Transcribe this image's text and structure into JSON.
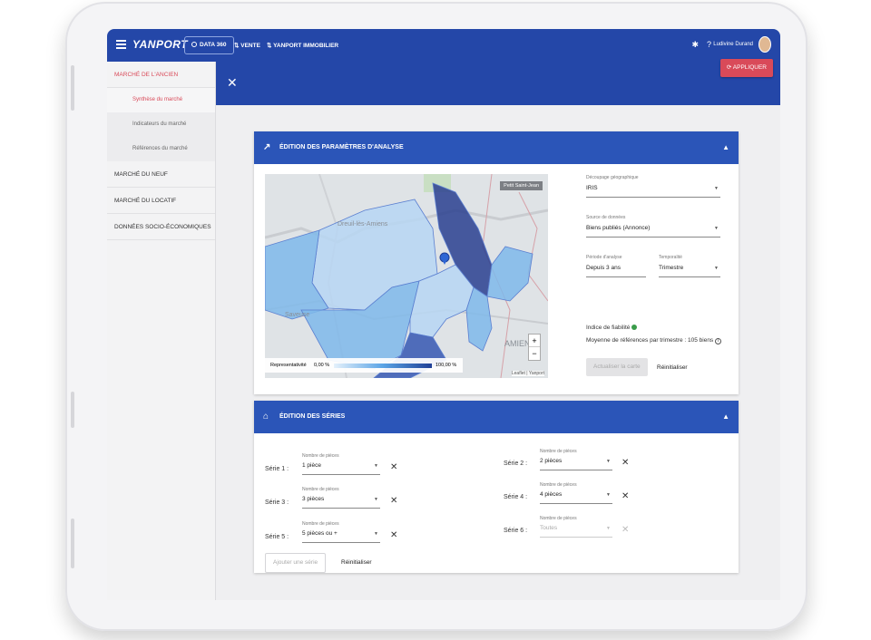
{
  "topbar": {
    "logo": "YANPORT",
    "module_chip": "DATA 360",
    "nav": [
      "VENTE",
      "YANPORT IMMOBILIER"
    ],
    "user_name": "Ludivine Durand"
  },
  "sidebar": {
    "sections": [
      {
        "label": "MARCHÉ DE L'ANCIEN",
        "active": true
      },
      {
        "label": "Synthèse du marché",
        "active": true
      },
      {
        "label": "Indicateurs du marché"
      },
      {
        "label": "Références du marché"
      },
      {
        "label": "MARCHÉ DU NEUF"
      },
      {
        "label": "MARCHÉ DU LOCATIF"
      },
      {
        "label": "DONNÉES SOCIO-ÉCONOMIQUES"
      }
    ]
  },
  "subbar": {
    "apply_label": "APPLIQUER"
  },
  "analysis": {
    "title": "ÉDITION DES PARAMÈTRES D'ANALYSE",
    "map": {
      "labels": [
        "Dreuil-lès-Amiens",
        "Saveuse",
        "AMIENS"
      ],
      "chip": "Petit Saint-Jean",
      "legend_label": "Representativité",
      "legend_min": "0,00 %",
      "legend_max": "100,00 %",
      "attribution": "Leaflet | Yanport",
      "zoom_in": "+",
      "zoom_out": "−",
      "colors": {
        "light": "#b7d6f3",
        "mid": "#7fb8ea",
        "dark": "#3657b1",
        "darkest": "#2a3f8f"
      }
    },
    "decoupage": {
      "label": "Découpage géographique",
      "value": "IRIS"
    },
    "source": {
      "label": "Source de données",
      "value": "Biens publiés (Annonce)"
    },
    "periode": {
      "label": "Période d'analyse",
      "value": "Depuis 3 ans"
    },
    "temporalite": {
      "label": "Temporalité",
      "value": "Trimestre"
    },
    "fiabilite": "Indice de fiabilité",
    "moyenne": "Moyenne de références par trimestre : 105 biens",
    "update_label": "Actualiser la carte",
    "reset_label": "Réinitialiser"
  },
  "series": {
    "title": "ÉDITION DES SÉRIES",
    "field_label": "Nombre de pièces",
    "items": [
      {
        "name": "Série 1 :",
        "value": "1 pièce"
      },
      {
        "name": "Série 2 :",
        "value": "2 pièces"
      },
      {
        "name": "Série 3 :",
        "value": "3 pièces"
      },
      {
        "name": "Série 4 :",
        "value": "4 pièces"
      },
      {
        "name": "Série 5 :",
        "value": "5 pièces ou +"
      },
      {
        "name": "Série 6 :",
        "value": "Toutes"
      }
    ],
    "add_label": "Ajouter une série",
    "reset_label": "Réinitialiser"
  }
}
